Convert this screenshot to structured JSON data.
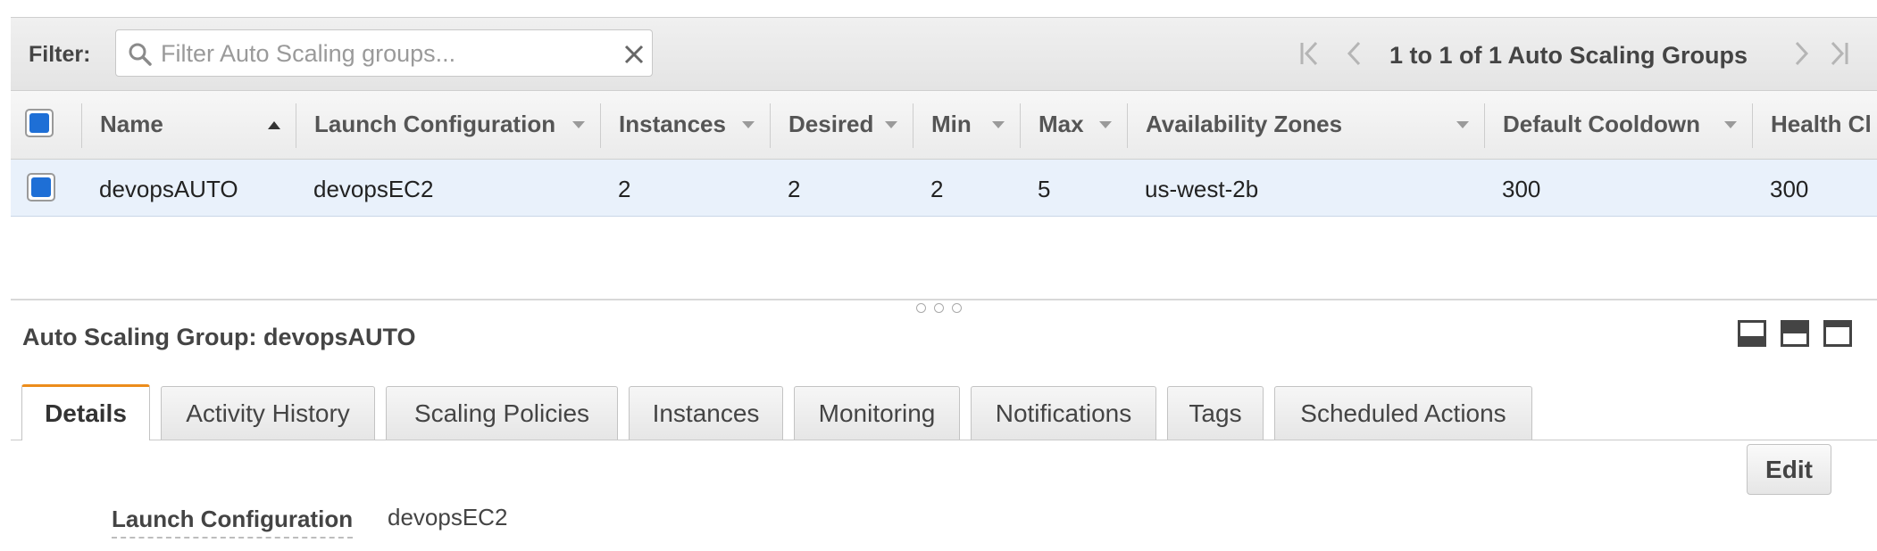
{
  "filter": {
    "label": "Filter:",
    "placeholder": "Filter Auto Scaling groups..."
  },
  "pager": {
    "text": "1 to 1 of 1 Auto Scaling Groups"
  },
  "table": {
    "columns": [
      {
        "label": "Name",
        "sort": "asc"
      },
      {
        "label": "Launch Configuration"
      },
      {
        "label": "Instances"
      },
      {
        "label": "Desired"
      },
      {
        "label": "Min"
      },
      {
        "label": "Max"
      },
      {
        "label": "Availability Zones"
      },
      {
        "label": "Default Cooldown"
      },
      {
        "label": "Health Cl"
      }
    ],
    "rows": [
      {
        "selected": true,
        "name": "devopsAUTO",
        "launch_configuration": "devopsEC2",
        "instances": "2",
        "desired": "2",
        "min": "2",
        "max": "5",
        "availability_zones": "us-west-2b",
        "default_cooldown": "300",
        "health_check": "300"
      }
    ]
  },
  "details": {
    "title": "Auto Scaling Group: devopsAUTO",
    "tabs": [
      {
        "label": "Details",
        "active": true
      },
      {
        "label": "Activity History"
      },
      {
        "label": "Scaling Policies"
      },
      {
        "label": "Instances"
      },
      {
        "label": "Monitoring"
      },
      {
        "label": "Notifications"
      },
      {
        "label": "Tags"
      },
      {
        "label": "Scheduled Actions"
      }
    ],
    "edit_label": "Edit",
    "fields": [
      {
        "label": "Launch Configuration",
        "value": "devopsEC2"
      }
    ]
  },
  "colors": {
    "accent_tab": "#ec8c1b",
    "checkbox": "#1e6fd6",
    "row_selected": "#e9f1fb"
  }
}
